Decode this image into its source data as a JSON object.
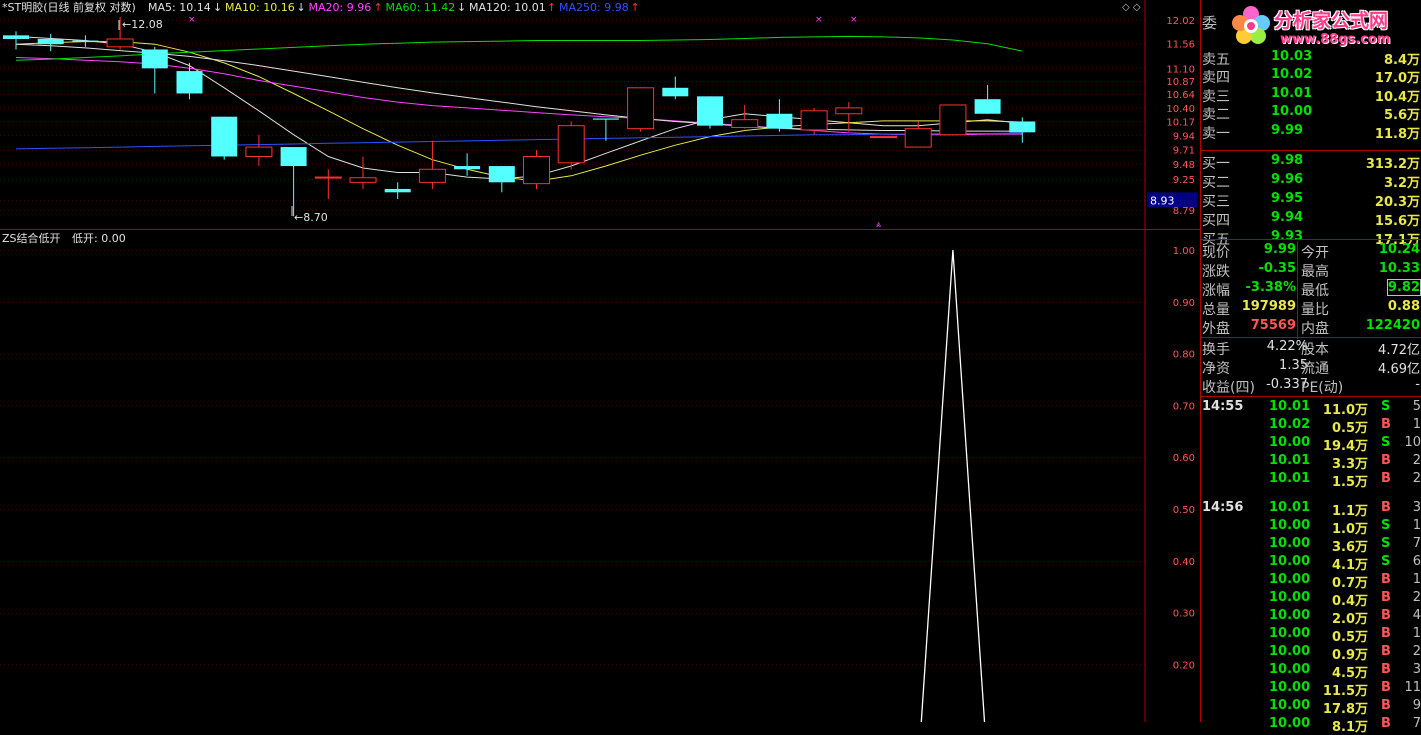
{
  "header": {
    "title": "*ST明胶(日线 前复权 对数)",
    "indicators": [
      {
        "label": "MA5: 10.14",
        "arrow": "↓",
        "color": "#e0e0e0"
      },
      {
        "label": "MA10: 10.16",
        "arrow": "↓",
        "color": "#e8e84a"
      },
      {
        "label": "MA20: 9.96",
        "arrow": "↑",
        "color": "#ff44ff"
      },
      {
        "label": "MA60: 11.42",
        "arrow": "↓",
        "color": "#00e000"
      },
      {
        "label": "MA120: 10.01",
        "arrow": "↑",
        "color": "#e0e0e0"
      },
      {
        "label": "MA250: 9.98",
        "arrow": "↑",
        "color": "#3050ff"
      }
    ]
  },
  "sub_header": {
    "name": "ZS结合低开",
    "value_label": "低开: 0.00"
  },
  "logo": {
    "brand": "分析家公式网",
    "url": "www.88gs.com"
  },
  "price_axis": {
    "ticks": [
      "12.02",
      "11.56",
      "11.10",
      "10.87",
      "10.64",
      "10.40",
      "10.17",
      "9.94",
      "9.71",
      "9.48",
      "9.25",
      "8.93",
      "8.79"
    ],
    "highlight": "8.93"
  },
  "sub_axis": {
    "ticks": [
      "1.00",
      "0.90",
      "0.80",
      "0.70",
      "0.60",
      "0.50",
      "0.40",
      "0.30",
      "0.20"
    ]
  },
  "markers": {
    "high": "12.08",
    "low": "8.70"
  },
  "chart_data": {
    "type": "candlestick",
    "title": "*ST明胶(日线 前复权 对数)",
    "ylim": [
      8.7,
      12.1
    ],
    "candles": [
      {
        "o": 11.72,
        "h": 11.8,
        "l": 11.45,
        "c": 11.65
      },
      {
        "o": 11.65,
        "h": 11.75,
        "l": 11.42,
        "c": 11.55
      },
      {
        "o": 11.62,
        "h": 11.72,
        "l": 11.5,
        "c": 11.6
      },
      {
        "o": 11.5,
        "h": 12.08,
        "l": 11.45,
        "c": 11.65
      },
      {
        "o": 11.45,
        "h": 11.5,
        "l": 10.65,
        "c": 11.1
      },
      {
        "o": 11.05,
        "h": 11.2,
        "l": 10.55,
        "c": 10.65
      },
      {
        "o": 10.25,
        "h": 10.25,
        "l": 9.55,
        "c": 9.6
      },
      {
        "o": 9.6,
        "h": 9.95,
        "l": 9.45,
        "c": 9.75
      },
      {
        "o": 9.75,
        "h": 9.75,
        "l": 8.7,
        "c": 9.45
      },
      {
        "o": 9.28,
        "h": 9.4,
        "l": 8.95,
        "c": 9.28
      },
      {
        "o": 9.2,
        "h": 9.6,
        "l": 9.1,
        "c": 9.27
      },
      {
        "o": 9.1,
        "h": 9.2,
        "l": 8.95,
        "c": 9.05
      },
      {
        "o": 9.2,
        "h": 9.85,
        "l": 9.1,
        "c": 9.4
      },
      {
        "o": 9.45,
        "h": 9.65,
        "l": 9.3,
        "c": 9.4
      },
      {
        "o": 9.45,
        "h": 9.45,
        "l": 9.05,
        "c": 9.2
      },
      {
        "o": 9.18,
        "h": 9.7,
        "l": 9.1,
        "c": 9.6
      },
      {
        "o": 9.5,
        "h": 10.17,
        "l": 9.4,
        "c": 10.1
      },
      {
        "o": 10.22,
        "h": 10.22,
        "l": 9.85,
        "c": 10.2
      },
      {
        "o": 10.05,
        "h": 10.75,
        "l": 10.0,
        "c": 10.75
      },
      {
        "o": 10.75,
        "h": 10.95,
        "l": 10.55,
        "c": 10.6
      },
      {
        "o": 10.6,
        "h": 10.6,
        "l": 10.05,
        "c": 10.1
      },
      {
        "o": 10.07,
        "h": 10.45,
        "l": 10.05,
        "c": 10.2
      },
      {
        "o": 10.3,
        "h": 10.55,
        "l": 10.0,
        "c": 10.05
      },
      {
        "o": 10.03,
        "h": 10.4,
        "l": 9.95,
        "c": 10.35
      },
      {
        "o": 10.3,
        "h": 10.5,
        "l": 10.0,
        "c": 10.4
      },
      {
        "o": 9.92,
        "h": 9.92,
        "l": 9.9,
        "c": 9.92
      },
      {
        "o": 9.75,
        "h": 10.17,
        "l": 9.75,
        "c": 10.05
      },
      {
        "o": 9.95,
        "h": 10.45,
        "l": 9.95,
        "c": 10.45
      },
      {
        "o": 10.55,
        "h": 10.8,
        "l": 10.3,
        "c": 10.3
      },
      {
        "o": 10.17,
        "h": 10.24,
        "l": 9.82,
        "c": 9.99
      }
    ],
    "ma": {
      "MA5": [
        11.7,
        11.66,
        11.62,
        11.55,
        11.4,
        11.15,
        10.75,
        10.35,
        9.95,
        9.6,
        9.42,
        9.35,
        9.35,
        9.28,
        9.25,
        9.3,
        9.45,
        9.65,
        9.85,
        10.05,
        10.2,
        10.3,
        10.25,
        10.2,
        10.15,
        10.1,
        10.1,
        10.15,
        10.2,
        10.14
      ],
      "MA10": [
        11.55,
        11.58,
        11.6,
        11.6,
        11.55,
        11.4,
        11.2,
        10.95,
        10.65,
        10.35,
        10.05,
        9.78,
        9.55,
        9.4,
        9.28,
        9.22,
        9.3,
        9.45,
        9.62,
        9.78,
        9.92,
        10.02,
        10.08,
        10.12,
        10.15,
        10.18,
        10.18,
        10.18,
        10.18,
        10.16
      ],
      "MA20": [
        11.3,
        11.28,
        11.25,
        11.22,
        11.18,
        11.1,
        11.0,
        10.88,
        10.78,
        10.68,
        10.58,
        10.5,
        10.44,
        10.4,
        10.36,
        10.32,
        10.28,
        10.25,
        10.22,
        10.18,
        10.14,
        10.1,
        10.06,
        10.02,
        9.98,
        9.96,
        9.95,
        9.95,
        9.96,
        9.96
      ],
      "MA60": [
        11.25,
        11.27,
        11.3,
        11.33,
        11.37,
        11.4,
        11.43,
        11.46,
        11.49,
        11.52,
        11.55,
        11.57,
        11.59,
        11.6,
        11.61,
        11.62,
        11.62,
        11.62,
        11.62,
        11.63,
        11.64,
        11.66,
        11.68,
        11.69,
        11.7,
        11.69,
        11.67,
        11.63,
        11.56,
        11.42
      ],
      "MA120": [
        11.55,
        11.52,
        11.48,
        11.43,
        11.38,
        11.32,
        11.24,
        11.15,
        11.05,
        10.95,
        10.85,
        10.75,
        10.66,
        10.58,
        10.5,
        10.42,
        10.35,
        10.28,
        10.22,
        10.17,
        10.13,
        10.09,
        10.06,
        10.04,
        10.03,
        10.02,
        10.02,
        10.01,
        10.01,
        10.01
      ],
      "MA250": [
        9.72,
        9.73,
        9.74,
        9.75,
        9.76,
        9.77,
        9.78,
        9.79,
        9.8,
        9.81,
        9.82,
        9.83,
        9.84,
        9.85,
        9.86,
        9.87,
        9.88,
        9.89,
        9.9,
        9.91,
        9.92,
        9.93,
        9.94,
        9.95,
        9.95,
        9.96,
        9.96,
        9.97,
        9.97,
        9.98
      ]
    },
    "sub_indicator": {
      "name": "低开",
      "values": [
        0,
        0,
        0,
        0,
        0,
        0,
        0,
        0,
        0,
        0,
        0,
        0,
        0,
        0,
        0,
        0,
        0,
        0,
        0,
        0,
        0,
        0,
        0,
        0,
        0,
        0,
        0.0,
        1.0,
        0.0,
        0
      ],
      "ylim": [
        0.0,
        1.0
      ]
    }
  },
  "order_book": {
    "committee_label": "委",
    "asks": [
      {
        "label": "卖五",
        "price": "10.03",
        "vol": "8.4万"
      },
      {
        "label": "卖四",
        "price": "10.02",
        "vol": "17.0万"
      },
      {
        "label": "卖三",
        "price": "10.01",
        "vol": "10.4万"
      },
      {
        "label": "卖二",
        "price": "10.00",
        "vol": "5.6万"
      },
      {
        "label": "卖一",
        "price": "9.99",
        "vol": "11.8万"
      }
    ],
    "bids": [
      {
        "label": "买一",
        "price": "9.98",
        "vol": "313.2万"
      },
      {
        "label": "买二",
        "price": "9.96",
        "vol": "3.2万"
      },
      {
        "label": "买三",
        "price": "9.95",
        "vol": "20.3万"
      },
      {
        "label": "买四",
        "price": "9.94",
        "vol": "15.6万"
      },
      {
        "label": "买五",
        "price": "9.93",
        "vol": "17.1万"
      }
    ]
  },
  "quote": [
    {
      "l1": "现价",
      "v1": "9.99",
      "c1": "c-green",
      "l2": "今开",
      "v2": "10.24",
      "c2": "c-green"
    },
    {
      "l1": "涨跌",
      "v1": "-0.35",
      "c1": "c-green",
      "l2": "最高",
      "v2": "10.33",
      "c2": "c-green"
    },
    {
      "l1": "涨幅",
      "v1": "-3.38%",
      "c1": "c-green",
      "l2": "最低",
      "v2": "9.82",
      "c2": "c-green"
    },
    {
      "l1": "总量",
      "v1": "197989",
      "c1": "c-yellow",
      "l2": "量比",
      "v2": "0.88",
      "c2": "c-yellow"
    },
    {
      "l1": "外盘",
      "v1": "75569",
      "c1": "c-red",
      "l2": "内盘",
      "v2": "122420",
      "c2": "c-green"
    }
  ],
  "stats": [
    {
      "l1": "换手",
      "v1": "4.22%",
      "l2": "股本",
      "v2": "4.72亿"
    },
    {
      "l1": "净资",
      "v1": "1.35",
      "l2": "流通",
      "v2": "4.69亿"
    },
    {
      "l1": "收益(四)",
      "v1": "-0.337",
      "l2": "PE(动)",
      "v2": "-"
    }
  ],
  "ticks": [
    {
      "time": "14:55",
      "price": "10.01",
      "vol": "11.0万",
      "bs": "S",
      "n": "5"
    },
    {
      "time": "",
      "price": "10.02",
      "vol": "0.5万",
      "bs": "B",
      "n": "1"
    },
    {
      "time": "",
      "price": "10.00",
      "vol": "19.4万",
      "bs": "S",
      "n": "10"
    },
    {
      "time": "",
      "price": "10.01",
      "vol": "3.3万",
      "bs": "B",
      "n": "2"
    },
    {
      "time": "",
      "price": "10.01",
      "vol": "1.5万",
      "bs": "B",
      "n": "2"
    },
    {
      "time": "14:56",
      "price": "10.01",
      "vol": "1.1万",
      "bs": "B",
      "n": "3"
    },
    {
      "time": "",
      "price": "10.00",
      "vol": "1.0万",
      "bs": "S",
      "n": "1"
    },
    {
      "time": "",
      "price": "10.00",
      "vol": "3.6万",
      "bs": "S",
      "n": "7"
    },
    {
      "time": "",
      "price": "10.00",
      "vol": "4.1万",
      "bs": "S",
      "n": "6"
    },
    {
      "time": "",
      "price": "10.00",
      "vol": "0.7万",
      "bs": "B",
      "n": "1"
    },
    {
      "time": "",
      "price": "10.00",
      "vol": "0.4万",
      "bs": "B",
      "n": "2"
    },
    {
      "time": "",
      "price": "10.00",
      "vol": "2.0万",
      "bs": "B",
      "n": "4"
    },
    {
      "time": "",
      "price": "10.00",
      "vol": "0.5万",
      "bs": "B",
      "n": "1"
    },
    {
      "time": "",
      "price": "10.00",
      "vol": "0.9万",
      "bs": "B",
      "n": "2"
    },
    {
      "time": "",
      "price": "10.00",
      "vol": "4.5万",
      "bs": "B",
      "n": "3"
    },
    {
      "time": "",
      "price": "10.00",
      "vol": "11.5万",
      "bs": "B",
      "n": "11"
    },
    {
      "time": "",
      "price": "10.00",
      "vol": "17.8万",
      "bs": "B",
      "n": "9"
    },
    {
      "time": "",
      "price": "10.00",
      "vol": "8.1万",
      "bs": "B",
      "n": "7"
    }
  ]
}
